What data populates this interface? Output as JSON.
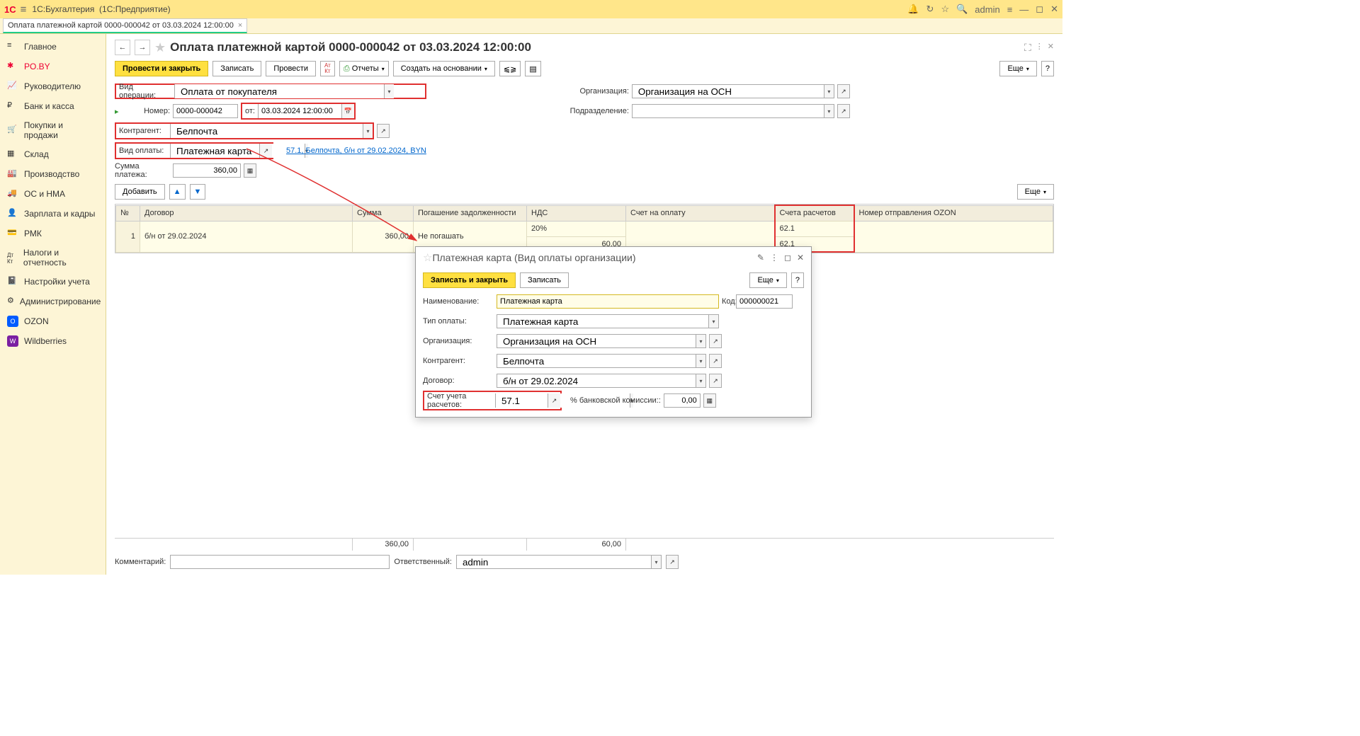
{
  "titlebar": {
    "app": "1С:Бухгалтерия",
    "sub": "(1С:Предприятие)",
    "user": "admin"
  },
  "tab": {
    "label": "Оплата платежной картой 0000-000042 от 03.03.2024 12:00:00"
  },
  "sidebar": {
    "items": [
      {
        "label": "Главное"
      },
      {
        "label": "PO.BY"
      },
      {
        "label": "Руководителю"
      },
      {
        "label": "Банк и касса"
      },
      {
        "label": "Покупки и продажи"
      },
      {
        "label": "Склад"
      },
      {
        "label": "Производство"
      },
      {
        "label": "ОС и НМА"
      },
      {
        "label": "Зарплата и кадры"
      },
      {
        "label": "РМК"
      },
      {
        "label": "Налоги и отчетность"
      },
      {
        "label": "Настройки учета"
      },
      {
        "label": "Администрирование"
      },
      {
        "label": "OZON"
      },
      {
        "label": "Wildberries"
      }
    ]
  },
  "page": {
    "title": "Оплата платежной картой 0000-000042 от 03.03.2024 12:00:00"
  },
  "toolbar": {
    "post_close": "Провести и закрыть",
    "save": "Записать",
    "post": "Провести",
    "reports": "Отчеты",
    "create_based": "Создать на основании",
    "more": "Еще"
  },
  "form": {
    "op_type_lbl": "Вид операции:",
    "op_type": "Оплата от покупателя",
    "number_lbl": "Номер:",
    "number": "0000-000042",
    "date_lbl": "от:",
    "date": "03.03.2024 12:00:00",
    "contr_lbl": "Контрагент:",
    "contr": "Белпочта",
    "pay_type_lbl": "Вид оплаты:",
    "pay_type": "Платежная карта",
    "contract_link": "57.1, Белпочта, б/н от 29.02.2024, BYN",
    "sum_lbl": "Сумма платежа:",
    "sum": "360,00",
    "org_lbl": "Организация:",
    "org": "Организация на ОСН",
    "div_lbl": "Подразделение:",
    "div": "",
    "add": "Добавить"
  },
  "grid": {
    "cols": [
      "№",
      "Договор",
      "Сумма",
      "Погашение задолженности",
      "НДС",
      "Счет на оплату",
      "Счета расчетов",
      "Номер отправления OZON"
    ],
    "rows": [
      {
        "n": "1",
        "dogovor": "б/н от 29.02.2024",
        "sum": "360,00",
        "pog": "Не погашать",
        "nds1": "20%",
        "nds2": "60,00",
        "acc1": "62.1",
        "acc2": "62.1"
      }
    ],
    "total_sum": "360,00",
    "total_nds": "60,00"
  },
  "footer": {
    "comment_lbl": "Комментарий:",
    "resp_lbl": "Ответственный:",
    "resp": "admin"
  },
  "dialog": {
    "title": "Платежная карта (Вид оплаты организации)",
    "save_close": "Записать и закрыть",
    "save": "Записать",
    "more": "Еще",
    "name_lbl": "Наименование:",
    "name": "Платежная карта",
    "code_lbl": "Код:",
    "code": "000000021",
    "paytype_lbl": "Тип оплаты:",
    "paytype": "Платежная карта",
    "org_lbl": "Организация:",
    "org": "Организация на ОСН",
    "contr_lbl": "Контрагент:",
    "contr": "Белпочта",
    "dogovor_lbl": "Договор:",
    "dogovor": "б/н от 29.02.2024",
    "acc_lbl": "Счет учета расчетов:",
    "acc": "57.1",
    "commission_lbl": "% банковской комиссии::",
    "commission": "0,00"
  }
}
